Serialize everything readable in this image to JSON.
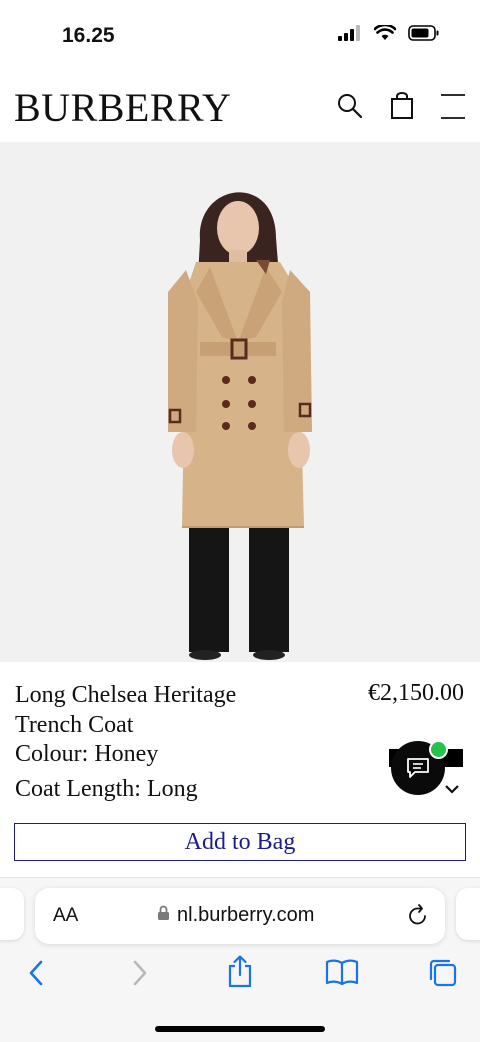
{
  "status_bar": {
    "time": "16.25"
  },
  "header": {
    "logo": "BURBERRY",
    "icons": [
      "search-icon",
      "shopping-bag-icon",
      "menu-icon"
    ]
  },
  "product": {
    "image_icon": "trench-coat-model-photo",
    "name": "Long Chelsea Heritage Trench Coat",
    "price": "€2,150.00",
    "colour": "Colour: Honey",
    "coat_length": "Coat Length: Long",
    "add_to_bag": "Add to Bag",
    "accent_color": "#1c1c8c"
  },
  "chat": {
    "icon": "chat-icon",
    "status_color": "#27c24c"
  },
  "browser": {
    "aa_label": "AA",
    "url": "nl.burberry.com",
    "icons": [
      "back-icon",
      "forward-icon",
      "share-icon",
      "bookmarks-icon",
      "tabs-icon"
    ]
  }
}
